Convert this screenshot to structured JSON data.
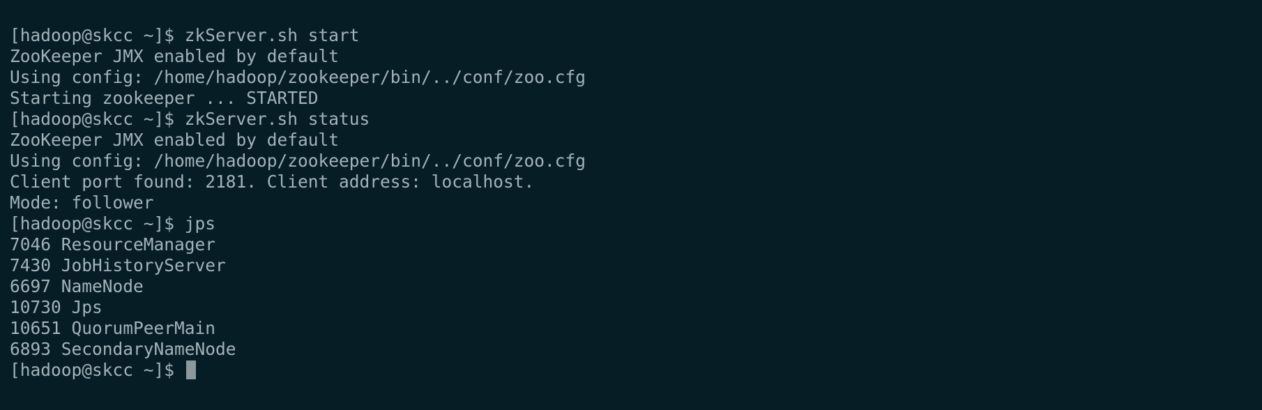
{
  "terminal": {
    "prompt": "[hadoop@skcc ~]$ ",
    "lines": [
      {
        "prompt": "[hadoop@skcc ~]$ ",
        "text": "zkServer.sh start"
      },
      {
        "prompt": "",
        "text": "ZooKeeper JMX enabled by default"
      },
      {
        "prompt": "",
        "text": "Using config: /home/hadoop/zookeeper/bin/../conf/zoo.cfg"
      },
      {
        "prompt": "",
        "text": "Starting zookeeper ... STARTED"
      },
      {
        "prompt": "[hadoop@skcc ~]$ ",
        "text": "zkServer.sh status"
      },
      {
        "prompt": "",
        "text": "ZooKeeper JMX enabled by default"
      },
      {
        "prompt": "",
        "text": "Using config: /home/hadoop/zookeeper/bin/../conf/zoo.cfg"
      },
      {
        "prompt": "",
        "text": "Client port found: 2181. Client address: localhost."
      },
      {
        "prompt": "",
        "text": "Mode: follower"
      },
      {
        "prompt": "[hadoop@skcc ~]$ ",
        "text": "jps"
      },
      {
        "prompt": "",
        "text": "7046 ResourceManager"
      },
      {
        "prompt": "",
        "text": "7430 JobHistoryServer"
      },
      {
        "prompt": "",
        "text": "6697 NameNode"
      },
      {
        "prompt": "",
        "text": "10730 Jps"
      },
      {
        "prompt": "",
        "text": "10651 QuorumPeerMain"
      },
      {
        "prompt": "",
        "text": "6893 SecondaryNameNode"
      }
    ],
    "colors": {
      "background": "#061d26",
      "foreground": "#a3b3b8",
      "cursor": "#8b999d"
    }
  }
}
